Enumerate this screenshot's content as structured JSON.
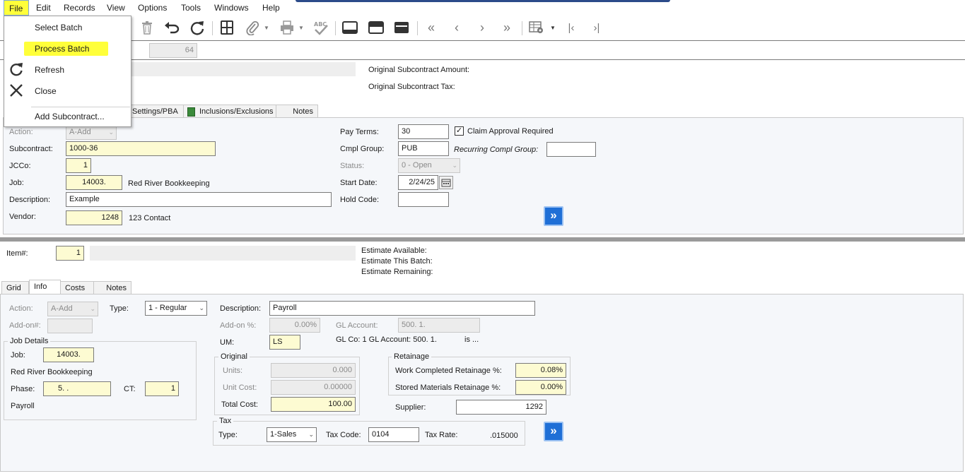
{
  "menubar": {
    "items": [
      "File",
      "Edit",
      "Records",
      "View",
      "Options",
      "Tools",
      "Windows",
      "Help"
    ]
  },
  "file_menu": {
    "select_batch": "Select Batch",
    "process_batch": "Process Batch",
    "refresh": "Refresh",
    "close": "Close",
    "add_subcontract": "Add Subcontract..."
  },
  "header": {
    "batch_value": "64",
    "original_amount_label": "Original Subcontract Amount:",
    "original_tax_label": "Original Subcontract Tax:"
  },
  "top_tabs": {
    "settings": "Settings/PBA",
    "inclusions": "Inclusions/Exclusions",
    "notes": "Notes"
  },
  "top_form": {
    "action_label": "Action:",
    "action_value": "A-Add",
    "subcontract_label": "Subcontract:",
    "subcontract_value": "1000-36",
    "jcco_label": "JCCo:",
    "jcco_value": "1",
    "job_label": "Job:",
    "job_value": "14003.",
    "job_name": "Red River Bookkeeping",
    "description_label": "Description:",
    "description_value": "Example",
    "vendor_label": "Vendor:",
    "vendor_value": "1248",
    "vendor_name": "123 Contact",
    "pay_terms_label": "Pay Terms:",
    "pay_terms_value": "30",
    "claim_approval_label": "Claim Approval Required",
    "claim_approval_checked": true,
    "cmpl_group_label": "Cmpl Group:",
    "cmpl_group_value": "PUB",
    "recurring_label": "Recurring Compl Group:",
    "recurring_value": "",
    "status_label": "Status:",
    "status_value": "0 - Open",
    "start_date_label": "Start Date:",
    "start_date_value": "2/24/25",
    "hold_code_label": "Hold Code:",
    "hold_code_value": ""
  },
  "item_header": {
    "item_label": "Item#:",
    "item_value": "1",
    "estimate_available": "Estimate Available:",
    "estimate_this_batch": "Estimate This Batch:",
    "estimate_remaining": "Estimate Remaining:"
  },
  "bottom_tabs": {
    "grid": "Grid",
    "info": "Info",
    "costs": "Costs",
    "notes": "Notes"
  },
  "bottom_form": {
    "action_label": "Action:",
    "action_value": "A-Add",
    "type_label": "Type:",
    "type_value": "1 - Regular",
    "addon_label": "Add-on#:",
    "addon_value": "",
    "description_label": "Description:",
    "description_value": "Payroll",
    "addon_pct_label": "Add-on %:",
    "addon_pct_value": "0.00%",
    "gl_account_label": "GL Account:",
    "gl_account_value": "500.  1.",
    "um_label": "UM:",
    "um_value": "LS",
    "gl_info_text": "GL Co: 1 GL Account:  500.  1.",
    "gl_is_text": "is ...",
    "job_details_title": "Job Details",
    "job_label": "Job:",
    "job_value": "14003.",
    "job_name": "Red River Bookkeeping",
    "phase_label": "Phase:",
    "phase_value": "5.   .",
    "ct_label": "CT:",
    "ct_value": "1",
    "phase_name": "Payroll",
    "original_title": "Original",
    "units_label": "Units:",
    "units_value": "0.000",
    "unit_cost_label": "Unit Cost:",
    "unit_cost_value": "0.00000",
    "total_cost_label": "Total Cost:",
    "total_cost_value": "100.00",
    "retainage_title": "Retainage",
    "wc_retainage_label": "Work Completed Retainage %:",
    "wc_retainage_value": "0.08%",
    "sm_retainage_label": "Stored Materials Retainage %:",
    "sm_retainage_value": "0.00%",
    "supplier_label": "Supplier:",
    "supplier_value": "1292",
    "tax_title": "Tax",
    "tax_type_label": "Type:",
    "tax_type_value": "1-Sales",
    "tax_code_label": "Tax Code:",
    "tax_code_value": "0104",
    "tax_rate_label": "Tax Rate:",
    "tax_rate_value": ".015000"
  },
  "colors": {
    "highlight": "#ffff3a",
    "required_field": "#fdfbd2",
    "panel_bg": "#f5f7fa",
    "accent_blue": "#1f6fd6"
  }
}
